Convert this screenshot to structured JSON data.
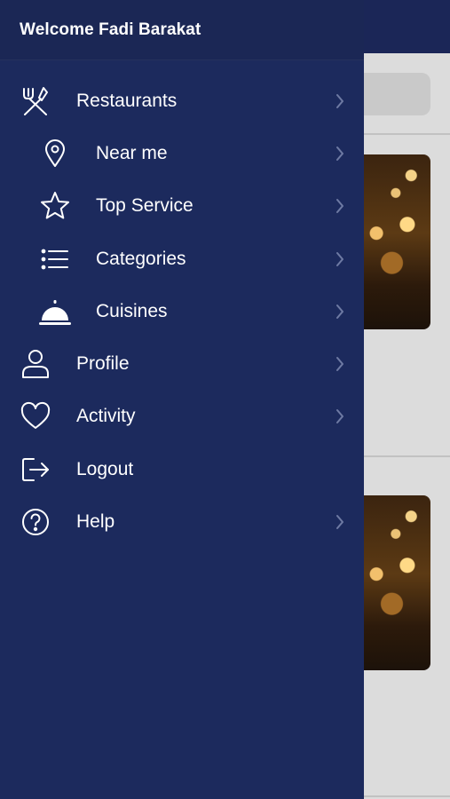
{
  "drawer": {
    "welcome_text": "Welcome Fadi Barakat",
    "items": [
      {
        "label": "Restaurants",
        "icon": "utensils-icon",
        "level": 0,
        "has_chevron": true
      },
      {
        "label": "Near me",
        "icon": "map-pin-icon",
        "level": 1,
        "has_chevron": true
      },
      {
        "label": "Top Service",
        "icon": "star-icon",
        "level": 1,
        "has_chevron": true
      },
      {
        "label": "Categories",
        "icon": "list-icon",
        "level": 1,
        "has_chevron": true
      },
      {
        "label": "Cuisines",
        "icon": "cloche-icon",
        "level": 1,
        "has_chevron": true
      },
      {
        "label": "Profile",
        "icon": "user-icon",
        "level": 0,
        "has_chevron": true
      },
      {
        "label": "Activity",
        "icon": "heart-icon",
        "level": 0,
        "has_chevron": true
      },
      {
        "label": "Logout",
        "icon": "logout-icon",
        "level": 0,
        "has_chevron": false
      },
      {
        "label": "Help",
        "icon": "help-circle-icon",
        "level": 0,
        "has_chevron": true
      }
    ]
  },
  "colors": {
    "drawer_bg": "#1c2a5d",
    "header_bg": "#1b2755",
    "text": "#ffffff",
    "chevron": "#6e7aa3",
    "background_app": "#dcdcdc"
  }
}
